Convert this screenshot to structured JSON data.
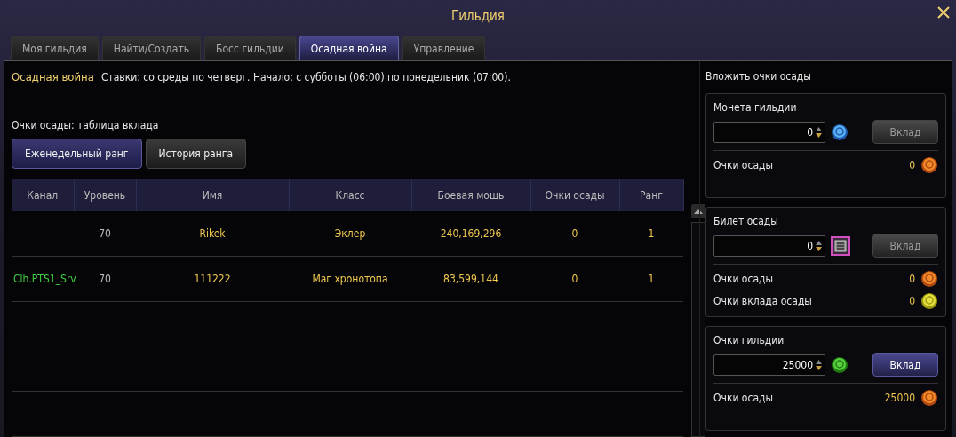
{
  "window": {
    "title": "Гильдия"
  },
  "tabs": [
    {
      "label": "Моя гильдия",
      "selected": false
    },
    {
      "label": "Найти/Создать",
      "selected": false
    },
    {
      "label": "Босс гильдии",
      "selected": false
    },
    {
      "label": "Осадная война",
      "selected": true
    },
    {
      "label": "Управление",
      "selected": false
    }
  ],
  "heading": "Осадная война",
  "notice": "Ставки: со среды по четверг. Начало: с субботы (06:00) по понедельник (07:00).",
  "table_caption": "Очки осады: таблица вклада",
  "subtabs": [
    {
      "label": "Еженедельный ранг",
      "selected": true
    },
    {
      "label": "История ранга",
      "selected": false
    }
  ],
  "table": {
    "columns": [
      "Канал",
      "Уровень",
      "Имя",
      "Класс",
      "Боевая мощь",
      "Очки осады",
      "Ранг"
    ],
    "rows": [
      {
        "level": "70",
        "name": "Rikek",
        "class": "Эклер",
        "power": "240,169,296",
        "points": "0",
        "rank": "1"
      },
      {
        "channel": "Clh.PTS1_Srv",
        "level": "70",
        "name": "111222",
        "class": "Маг хронотопа",
        "power": "83,599,144",
        "points": "0",
        "rank": "1"
      }
    ]
  },
  "invest": {
    "title": "Вложить очки осады",
    "sections": [
      {
        "title": "Монета гильдии",
        "value": "0",
        "kind": "coin",
        "button": {
          "label": "Вклад",
          "disabled": true
        },
        "rows": [
          {
            "label": "Очки осады",
            "value": "0",
            "kind": "sw"
          }
        ]
      },
      {
        "title": "Билет осады",
        "value": "0",
        "kind": "ticket",
        "button": {
          "label": "Вклад",
          "disabled": true
        },
        "rows": [
          {
            "label": "Очки осады",
            "value": "0",
            "kind": "sw"
          },
          {
            "label": "Очки вклада осады",
            "value": "0",
            "kind": "sg"
          }
        ]
      },
      {
        "title": "Очки гильдии",
        "value": "25000",
        "kind": "mg",
        "button": {
          "label": "Вклад",
          "disabled": false
        },
        "rows": [
          {
            "label": "Очки осады",
            "value": "25000",
            "kind": "sw"
          }
        ]
      }
    ]
  }
}
